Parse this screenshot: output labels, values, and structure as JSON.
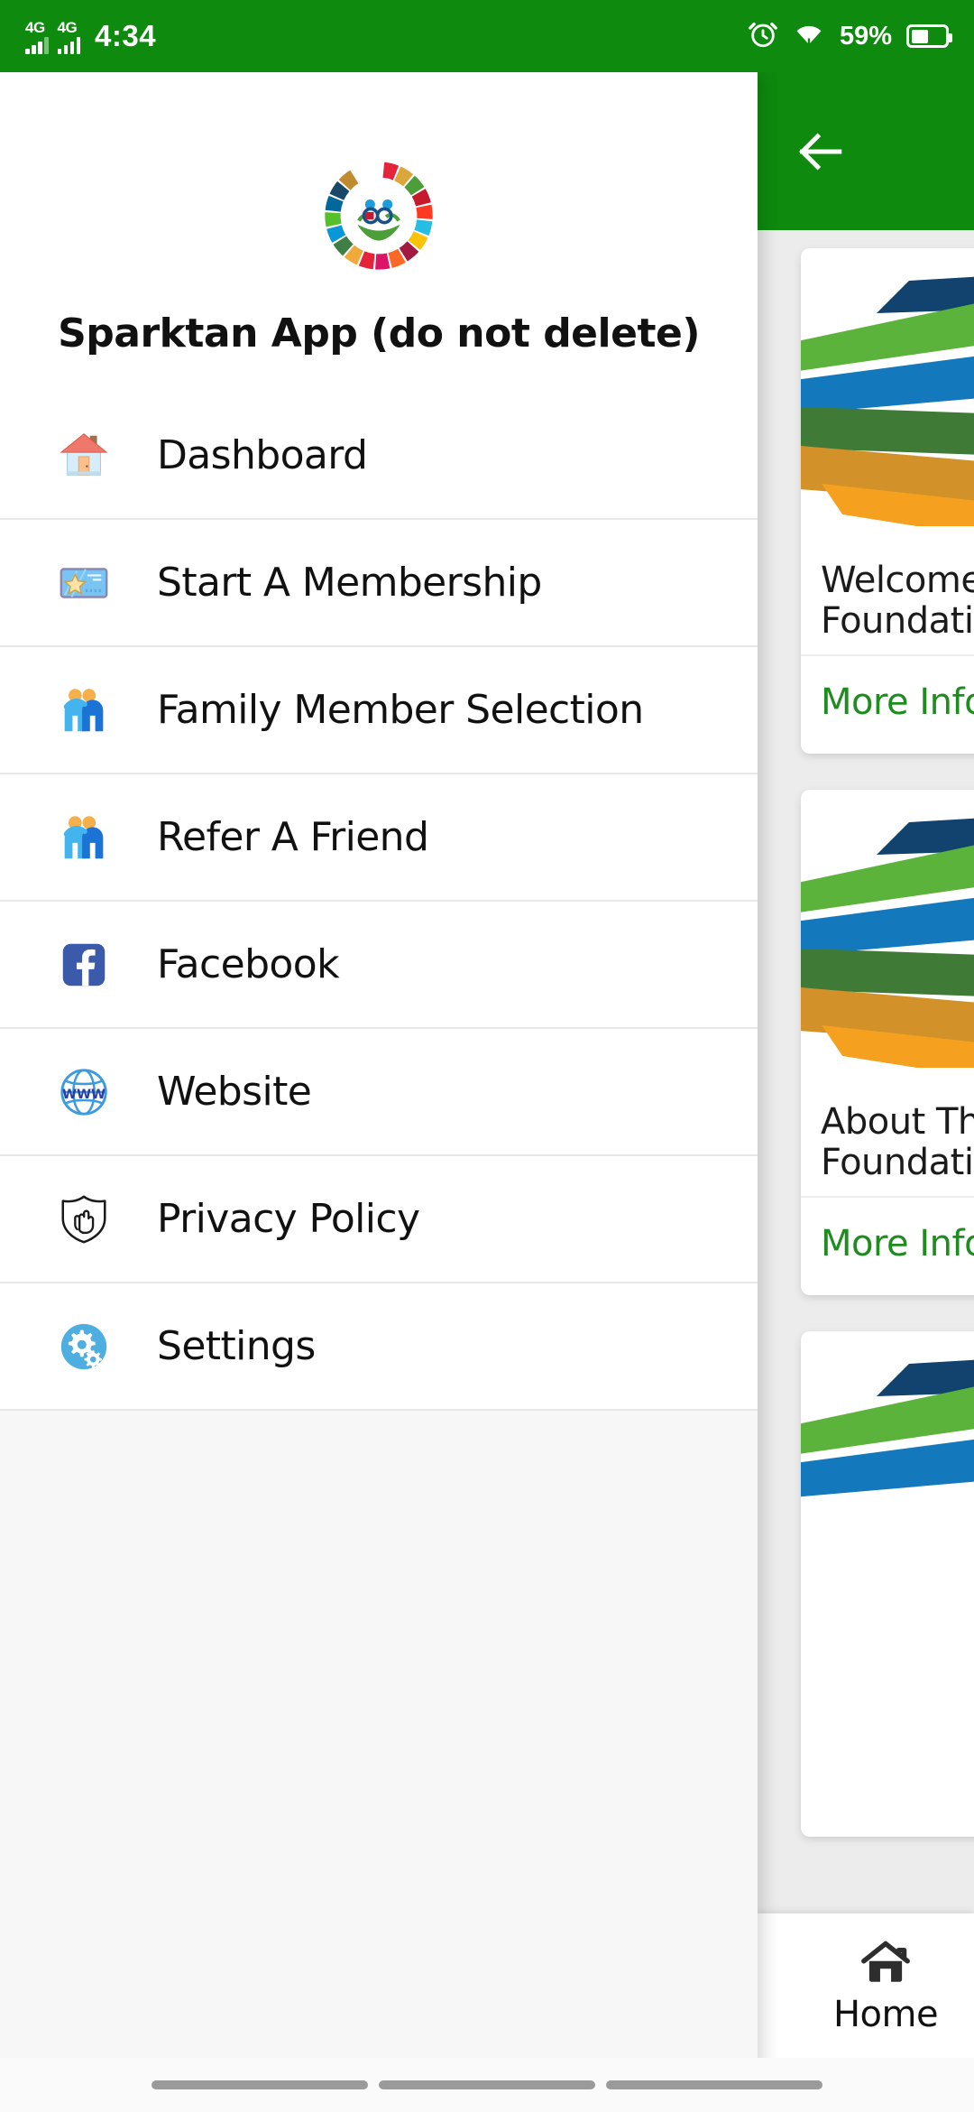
{
  "statusbar": {
    "network_1": "4G",
    "network_2": "4G",
    "time": "4:34",
    "battery_percent": "59%",
    "icons": [
      "alarm-icon",
      "wifi-icon",
      "battery-icon"
    ]
  },
  "appbar": {
    "back_icon": "back-arrow-icon",
    "background_color": "#0E8A0E"
  },
  "drawer": {
    "logo_name": "sdg-wheel-logo",
    "title": "Sparktan App (do not delete)",
    "items": [
      {
        "label": "Dashboard",
        "icon": "house-icon"
      },
      {
        "label": "Start A Membership",
        "icon": "ticket-star-icon"
      },
      {
        "label": "Family Member Selection",
        "icon": "two-people-icon"
      },
      {
        "label": "Refer A Friend",
        "icon": "two-people-icon"
      },
      {
        "label": "Facebook",
        "icon": "facebook-icon"
      },
      {
        "label": "Website",
        "icon": "www-globe-icon"
      },
      {
        "label": "Privacy Policy",
        "icon": "shield-hand-icon"
      },
      {
        "label": "Settings",
        "icon": "gear-icon"
      }
    ]
  },
  "main": {
    "cards": [
      {
        "title": "Welcome To The\nFoundation",
        "action": "More Info",
        "image": "foundation-leaf-logo"
      },
      {
        "title": "About The\nFoundation",
        "action": "More Info",
        "image": "foundation-leaf-logo"
      },
      {
        "title": "",
        "action": "",
        "image": "foundation-leaf-logo"
      }
    ],
    "accent_color": "#1F8C1F"
  },
  "bottomnav": {
    "items": [
      {
        "label": "Home",
        "icon": "home-icon"
      }
    ]
  },
  "gesturenav": {
    "pill_count": 3
  }
}
